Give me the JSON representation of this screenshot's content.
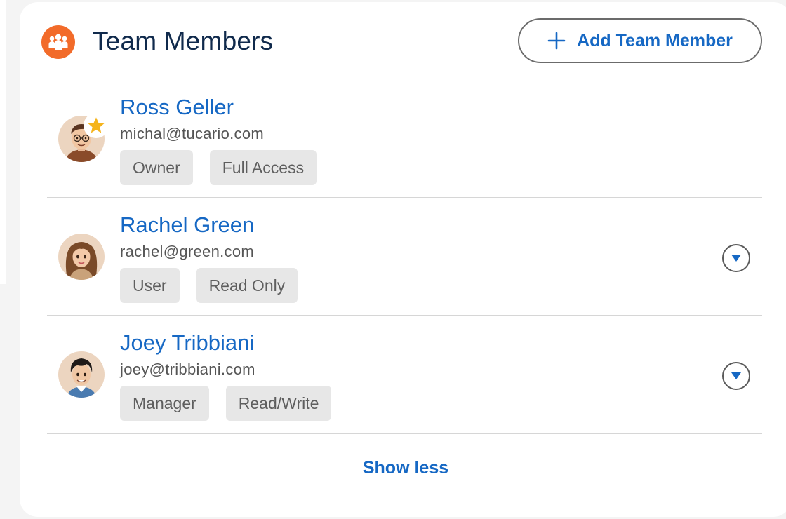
{
  "header": {
    "title": "Team Members",
    "icon": "team-icon",
    "add_button_label": "Add Team Member"
  },
  "members": [
    {
      "name": "Ross Geller",
      "email": "michal@tucario.com",
      "role": "Owner",
      "access": "Full Access",
      "starred": true,
      "avatar": "avatar-man-glasses"
    },
    {
      "name": "Rachel Green",
      "email": "rachel@green.com",
      "role": "User",
      "access": "Read Only",
      "starred": false,
      "avatar": "avatar-woman"
    },
    {
      "name": "Joey Tribbiani",
      "email": "joey@tribbiani.com",
      "role": "Manager",
      "access": "Read/Write",
      "starred": false,
      "avatar": "avatar-man"
    }
  ],
  "footer": {
    "toggle_label": "Show less"
  },
  "colors": {
    "accent": "#1668c4",
    "title": "#102a4c",
    "icon_bg": "#f26b2a",
    "chip_bg": "#e7e7e7",
    "star": "#f5b41c"
  }
}
